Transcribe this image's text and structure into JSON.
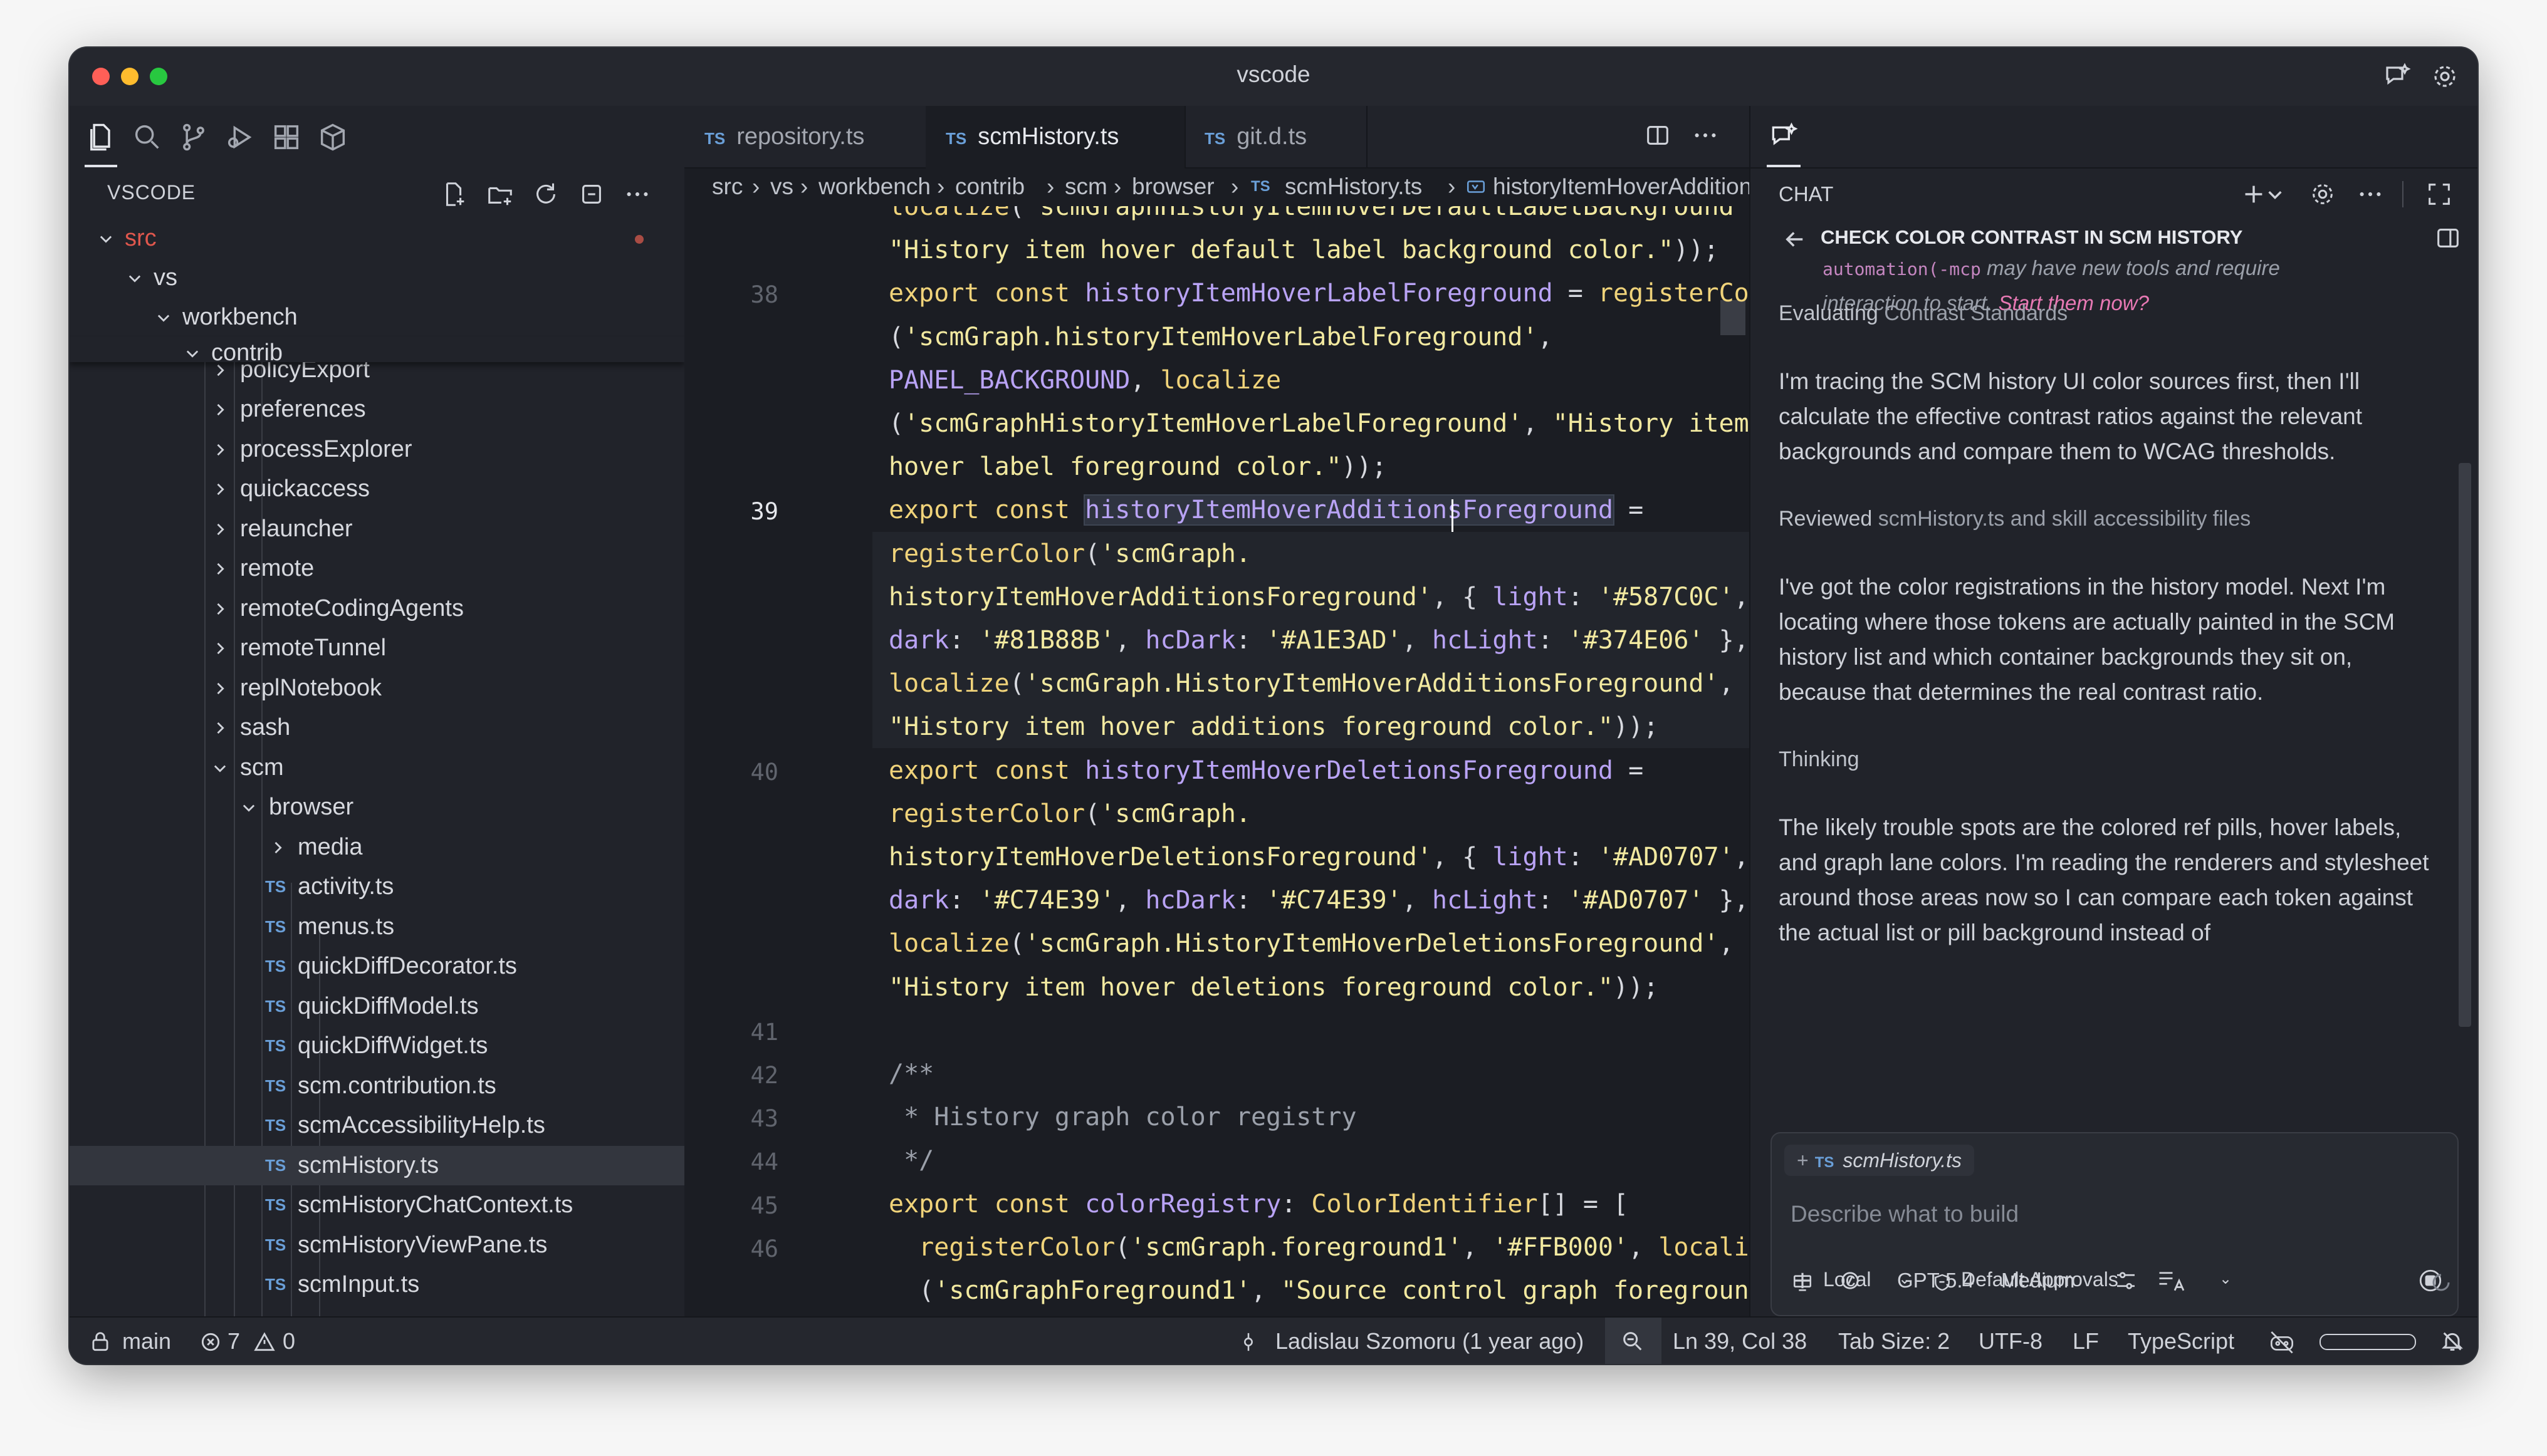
{
  "window": {
    "title": "vscode",
    "traffic_colors": [
      "#ff5f57",
      "#febc2e",
      "#28c840"
    ]
  },
  "explorer": {
    "title": "VSCODE",
    "tree": [
      {
        "label": "src",
        "kind": "folder-open",
        "color": "#e0574d"
      },
      {
        "label": "vs",
        "kind": "folder-open"
      },
      {
        "label": "workbench",
        "kind": "folder-open"
      },
      {
        "label": "contrib",
        "kind": "folder-open"
      },
      {
        "label": "policyExport",
        "kind": "folder"
      },
      {
        "label": "preferences",
        "kind": "folder"
      },
      {
        "label": "processExplorer",
        "kind": "folder"
      },
      {
        "label": "quickaccess",
        "kind": "folder"
      },
      {
        "label": "relauncher",
        "kind": "folder"
      },
      {
        "label": "remote",
        "kind": "folder"
      },
      {
        "label": "remoteCodingAgents",
        "kind": "folder"
      },
      {
        "label": "remoteTunnel",
        "kind": "folder"
      },
      {
        "label": "replNotebook",
        "kind": "folder"
      },
      {
        "label": "sash",
        "kind": "folder"
      },
      {
        "label": "scm",
        "kind": "folder-open"
      },
      {
        "label": "browser",
        "kind": "folder-open"
      },
      {
        "label": "media",
        "kind": "folder"
      },
      {
        "label": "activity.ts",
        "kind": "file"
      },
      {
        "label": "menus.ts",
        "kind": "file"
      },
      {
        "label": "quickDiffDecorator.ts",
        "kind": "file"
      },
      {
        "label": "quickDiffModel.ts",
        "kind": "file"
      },
      {
        "label": "quickDiffWidget.ts",
        "kind": "file"
      },
      {
        "label": "scm.contribution.ts",
        "kind": "file"
      },
      {
        "label": "scmAccessibilityHelp.ts",
        "kind": "file"
      },
      {
        "label": "scmHistory.ts",
        "kind": "file",
        "active": true
      },
      {
        "label": "scmHistoryChatContext.ts",
        "kind": "file"
      },
      {
        "label": "scmHistoryViewPane.ts",
        "kind": "file"
      },
      {
        "label": "scmInput.ts",
        "kind": "file"
      }
    ]
  },
  "editor": {
    "ts_badge": "TS",
    "tabs": [
      {
        "label": "repository.ts"
      },
      {
        "label": "scmHistory.ts",
        "active": true
      },
      {
        "label": "git.d.ts"
      }
    ],
    "breadcrumb": [
      "src",
      "vs",
      "workbench",
      "contrib",
      "scm",
      "browser",
      "scmHistory.ts",
      "historyItemHoverAdditionsForeground"
    ],
    "line_numbers": [
      "38",
      "39",
      "40",
      "41",
      "42",
      "43",
      "44",
      "45",
      "46"
    ],
    "code": [
      {
        "t": [
          {
            "c": "f",
            "x": "localize"
          },
          {
            "c": "p",
            "x": "("
          },
          {
            "c": "s",
            "x": "'scmGraphHistoryItemHoverDefaultLabelBackground'"
          },
          {
            "c": "p",
            "x": ","
          }
        ]
      },
      {
        "t": [
          {
            "c": "s",
            "x": "\"History item hover default label background color.\""
          },
          {
            "c": "p",
            "x": "));"
          }
        ]
      },
      {
        "t": [
          {
            "c": "k",
            "x": "export"
          },
          {
            "c": "p",
            "x": " "
          },
          {
            "c": "k",
            "x": "const"
          },
          {
            "c": "p",
            "x": " "
          },
          {
            "c": "v",
            "x": "historyItemHoverLabelForeground"
          },
          {
            "c": "p",
            "x": " = "
          },
          {
            "c": "f",
            "x": "registerColor"
          }
        ]
      },
      {
        "t": [
          {
            "c": "p",
            "x": "("
          },
          {
            "c": "s",
            "x": "'scmGraph.historyItemHoverLabelForeground'"
          },
          {
            "c": "p",
            "x": ","
          }
        ]
      },
      {
        "t": [
          {
            "c": "v",
            "x": "PANEL_BACKGROUND"
          },
          {
            "c": "p",
            "x": ", "
          },
          {
            "c": "f",
            "x": "localize"
          }
        ]
      },
      {
        "t": [
          {
            "c": "p",
            "x": "("
          },
          {
            "c": "s",
            "x": "'scmGraphHistoryItemHoverLabelForeground'"
          },
          {
            "c": "p",
            "x": ", "
          },
          {
            "c": "s",
            "x": "\"History item"
          }
        ]
      },
      {
        "t": [
          {
            "c": "s",
            "x": "hover label foreground color.\""
          },
          {
            "c": "p",
            "x": "));"
          }
        ]
      },
      {
        "t": [
          {
            "c": "k",
            "x": "export"
          },
          {
            "c": "p",
            "x": " "
          },
          {
            "c": "k",
            "x": "const"
          },
          {
            "c": "p",
            "x": " "
          },
          {
            "c": "v hl",
            "x": "historyItemHoverAdditionsForeground"
          },
          {
            "c": "p",
            "x": " ="
          }
        ]
      },
      {
        "t": [
          {
            "c": "f",
            "x": "registerColor"
          },
          {
            "c": "p",
            "x": "("
          },
          {
            "c": "s",
            "x": "'scmGraph."
          }
        ]
      },
      {
        "t": [
          {
            "c": "s",
            "x": "historyItemHoverAdditionsForeground'"
          },
          {
            "c": "p",
            "x": ", { "
          },
          {
            "c": "v",
            "x": "light"
          },
          {
            "c": "p",
            "x": ": "
          },
          {
            "c": "s",
            "x": "'#587C0C'"
          },
          {
            "c": "p",
            "x": ","
          }
        ]
      },
      {
        "t": [
          {
            "c": "v",
            "x": "dark"
          },
          {
            "c": "p",
            "x": ": "
          },
          {
            "c": "s",
            "x": "'#81B88B'"
          },
          {
            "c": "p",
            "x": ", "
          },
          {
            "c": "v",
            "x": "hcDark"
          },
          {
            "c": "p",
            "x": ": "
          },
          {
            "c": "s",
            "x": "'#A1E3AD'"
          },
          {
            "c": "p",
            "x": ", "
          },
          {
            "c": "v",
            "x": "hcLight"
          },
          {
            "c": "p",
            "x": ": "
          },
          {
            "c": "s",
            "x": "'#374E06'"
          },
          {
            "c": "p",
            "x": " },"
          }
        ]
      },
      {
        "t": [
          {
            "c": "f",
            "x": "localize"
          },
          {
            "c": "p",
            "x": "("
          },
          {
            "c": "s",
            "x": "'scmGraph.HistoryItemHoverAdditionsForeground'"
          },
          {
            "c": "p",
            "x": ","
          }
        ]
      },
      {
        "t": [
          {
            "c": "s",
            "x": "\"History item hover additions foreground color.\""
          },
          {
            "c": "p",
            "x": "));"
          }
        ]
      },
      {
        "t": [
          {
            "c": "k",
            "x": "export"
          },
          {
            "c": "p",
            "x": " "
          },
          {
            "c": "k",
            "x": "const"
          },
          {
            "c": "p",
            "x": " "
          },
          {
            "c": "v",
            "x": "historyItemHoverDeletionsForeground"
          },
          {
            "c": "p",
            "x": " ="
          }
        ]
      },
      {
        "t": [
          {
            "c": "f",
            "x": "registerColor"
          },
          {
            "c": "p",
            "x": "("
          },
          {
            "c": "s",
            "x": "'scmGraph."
          }
        ]
      },
      {
        "t": [
          {
            "c": "s",
            "x": "historyItemHoverDeletionsForeground'"
          },
          {
            "c": "p",
            "x": ", { "
          },
          {
            "c": "v",
            "x": "light"
          },
          {
            "c": "p",
            "x": ": "
          },
          {
            "c": "s",
            "x": "'#AD0707'"
          },
          {
            "c": "p",
            "x": ","
          }
        ]
      },
      {
        "t": [
          {
            "c": "v",
            "x": "dark"
          },
          {
            "c": "p",
            "x": ": "
          },
          {
            "c": "s",
            "x": "'#C74E39'"
          },
          {
            "c": "p",
            "x": ", "
          },
          {
            "c": "v",
            "x": "hcDark"
          },
          {
            "c": "p",
            "x": ": "
          },
          {
            "c": "s",
            "x": "'#C74E39'"
          },
          {
            "c": "p",
            "x": ", "
          },
          {
            "c": "v",
            "x": "hcLight"
          },
          {
            "c": "p",
            "x": ": "
          },
          {
            "c": "s",
            "x": "'#AD0707'"
          },
          {
            "c": "p",
            "x": " },"
          }
        ]
      },
      {
        "t": [
          {
            "c": "f",
            "x": "localize"
          },
          {
            "c": "p",
            "x": "("
          },
          {
            "c": "s",
            "x": "'scmGraph.HistoryItemHoverDeletionsForeground'"
          },
          {
            "c": "p",
            "x": ","
          }
        ]
      },
      {
        "t": [
          {
            "c": "s",
            "x": "\"History item hover deletions foreground color.\""
          },
          {
            "c": "p",
            "x": "));"
          }
        ]
      },
      {
        "t": []
      },
      {
        "t": [
          {
            "c": "c",
            "x": "/**"
          }
        ]
      },
      {
        "t": [
          {
            "c": "c",
            "x": " * History graph color registry"
          }
        ]
      },
      {
        "t": [
          {
            "c": "c",
            "x": " */"
          }
        ]
      },
      {
        "t": [
          {
            "c": "k",
            "x": "export"
          },
          {
            "c": "p",
            "x": " "
          },
          {
            "c": "k",
            "x": "const"
          },
          {
            "c": "p",
            "x": " "
          },
          {
            "c": "v",
            "x": "colorRegistry"
          },
          {
            "c": "p",
            "x": ": "
          },
          {
            "c": "t",
            "x": "ColorIdentifier"
          },
          {
            "c": "p",
            "x": "[] = ["
          }
        ]
      },
      {
        "t": [
          {
            "c": "p",
            "x": "  "
          },
          {
            "c": "f",
            "x": "registerColor"
          },
          {
            "c": "p",
            "x": "("
          },
          {
            "c": "s",
            "x": "'scmGraph.foreground1'"
          },
          {
            "c": "p",
            "x": ", "
          },
          {
            "c": "s",
            "x": "'#FFB000'"
          },
          {
            "c": "p",
            "x": ", "
          },
          {
            "c": "f",
            "x": "localize"
          }
        ]
      },
      {
        "t": [
          {
            "c": "p",
            "x": "  ("
          },
          {
            "c": "s",
            "x": "'scmGraphForeground1'"
          },
          {
            "c": "p",
            "x": ", "
          },
          {
            "c": "s",
            "x": "\"Source control graph foreground"
          }
        ]
      }
    ]
  },
  "chat": {
    "label": "CHAT",
    "subtitle": "CHECK COLOR CONTRAST IN SCM HISTORY",
    "notice_code": "automation(-mcp",
    "notice_text": " may have new tools and require",
    "notice_line2": "interaction to start. ",
    "notice_link": "Start them now?",
    "step1_label": "Evaluating",
    "step1_value": "Contrast Standards",
    "para1": "I'm tracing the SCM history UI color sources first, then I'll calculate the effective contrast ratios against the relevant backgrounds and compare them to WCAG thresholds.",
    "step2_label": "Reviewed",
    "step2_value": "scmHistory.ts and skill accessibility files",
    "para2": "I've got the color registrations in the history model. Next I'm locating where those tokens are actually painted in the SCM history list and which container backgrounds they sit on, because that determines the real contrast ratio.",
    "step3_label": "Thinking",
    "para3": "The likely trouble spots are the colored ref pills, hover labels, and graph lane colors. I'm reading the renderers and stylesheet around those areas now so I can compare each token against the actual list or pill background instead of",
    "context_file": "scmHistory.ts",
    "input_placeholder": "Describe what to build",
    "model": "GPT-5.4",
    "effort": "Medium",
    "footer_location": "Local",
    "footer_approvals": "Default Approvals"
  },
  "statusbar": {
    "branch": "main",
    "errors": "7",
    "warnings": "0",
    "blame": "Ladislau Szomoru (1 year ago)",
    "position": "Ln 39, Col 38",
    "tab_size": "Tab Size: 2",
    "encoding": "UTF-8",
    "eol": "LF",
    "language": "TypeScript"
  }
}
